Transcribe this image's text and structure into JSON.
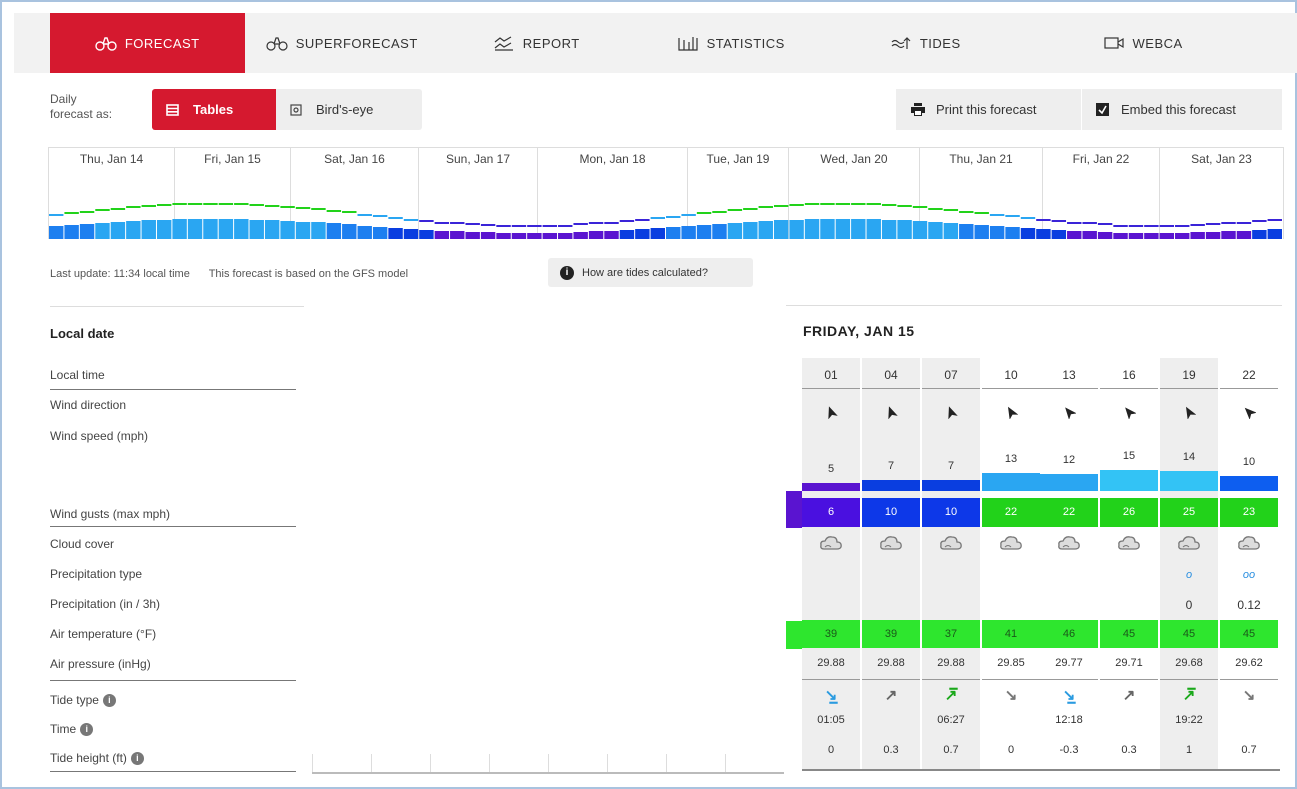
{
  "nav": [
    {
      "label": "FORECAST",
      "icon": "binoculars-icon",
      "active": true
    },
    {
      "label": "SUPERFORECAST",
      "icon": "binoculars-icon",
      "active": false
    },
    {
      "label": "REPORT",
      "icon": "report-icon",
      "active": false
    },
    {
      "label": "STATISTICS",
      "icon": "statistics-icon",
      "active": false
    },
    {
      "label": "TIDES",
      "icon": "tides-icon",
      "active": false
    },
    {
      "label": "WEBCA",
      "icon": "webcam-icon",
      "active": false
    }
  ],
  "controls": {
    "daily_label_1": "Daily",
    "daily_label_2": "forecast as:",
    "tables": "Tables",
    "birdseye": "Bird's-eye",
    "print": "Print this forecast",
    "embed": "Embed this forecast"
  },
  "overview": {
    "days": [
      "Thu, Jan 14",
      "Fri, Jan 15",
      "Sat, Jan 16",
      "Sun, Jan 17",
      "Mon, Jan 18",
      "Tue, Jan 19",
      "Wed, Jan 20",
      "Thu, Jan 21",
      "Fri, Jan 22",
      "Sat, Jan 23"
    ]
  },
  "info": {
    "last_update": "Last update: 11:34 local time",
    "model": "This forecast is based on the GFS model",
    "tides_button": "How are tides calculated?"
  },
  "labels": {
    "local_date": "Local date",
    "local_time": "Local time",
    "wind_direction": "Wind direction",
    "wind_speed": "Wind speed  (mph)",
    "wind_gusts": "Wind gusts  (max mph)",
    "cloud_cover": "Cloud cover",
    "precip_type": "Precipitation type",
    "precip": "Precipitation  (in / 3h)",
    "air_temp": "Air temperature  (°F)",
    "air_pressure": "Air pressure  (inHg)",
    "tide_type": "Tide type",
    "time": "Time",
    "tide_height": "Tide height  (ft)"
  },
  "day": {
    "title": "FRIDAY, JAN 15",
    "hours": [
      "01",
      "04",
      "07",
      "10",
      "13",
      "16",
      "19",
      "22"
    ],
    "wind_speed": [
      "5",
      "7",
      "7",
      "13",
      "12",
      "15",
      "14",
      "10"
    ],
    "wind_gusts": [
      "6",
      "10",
      "10",
      "22",
      "22",
      "26",
      "25",
      "23"
    ],
    "precip_type": [
      "",
      "",
      "",
      "",
      "",
      "",
      "rain-drop",
      "rain-drops"
    ],
    "precip": [
      "",
      "",
      "",
      "",
      "",
      "",
      "0",
      "0.12"
    ],
    "air_temp": [
      "39",
      "39",
      "37",
      "41",
      "46",
      "45",
      "45",
      "45"
    ],
    "air_pressure": [
      "29.88",
      "29.88",
      "29.88",
      "29.85",
      "29.77",
      "29.71",
      "29.68",
      "29.62"
    ],
    "tide_type": [
      "low-falling",
      "rising",
      "high-rising",
      "falling",
      "low-falling",
      "rising",
      "high-rising",
      "falling"
    ],
    "tide_time": [
      "01:05",
      "",
      "06:27",
      "",
      "12:18",
      "",
      "19:22",
      ""
    ],
    "tide_height": [
      "0",
      "0.3",
      "0.7",
      "0",
      "-0.3",
      "0.3",
      "1",
      "0.7"
    ]
  },
  "colors": {
    "accent": "#d5192f",
    "wind_slow": "#5a14d0",
    "wind_mid": "#0a3ee0",
    "wind_fast": "#2aa6f2",
    "wind_fastest": "#33c3f5",
    "gust_low": "#4a10e0",
    "gust_mid": "#0d38e8",
    "gust_high": "#22d21a",
    "temp": "#2ee62e"
  }
}
